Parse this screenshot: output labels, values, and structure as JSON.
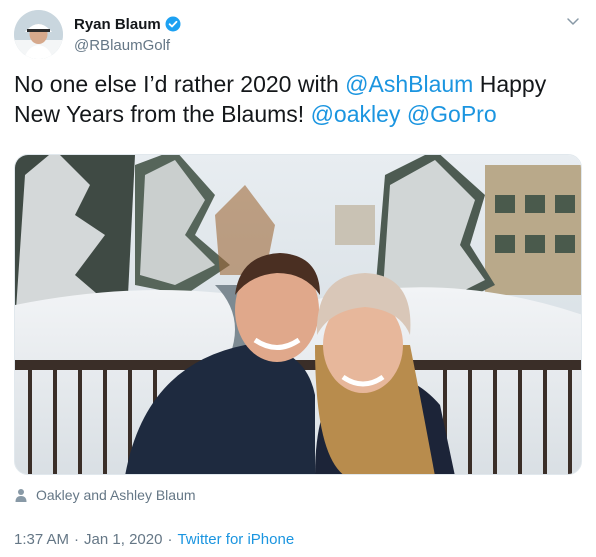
{
  "user": {
    "display_name": "Ryan Blaum",
    "handle": "@RBlaumGolf",
    "verified_icon": "verified-badge-icon",
    "caret_icon": "chevron-down-icon"
  },
  "tweet": {
    "text_part1": "No one else I’d rather 2020 with ",
    "mention1": "@AshBlaum",
    "text_part2": " Happy New Years from the Blaums! ",
    "mention2": "@oakley",
    "text_part3": " ",
    "mention3": "@GoPro"
  },
  "media": {
    "tagged_icon": "person-icon",
    "tagged_label": "Oakley and Ashley Blaum"
  },
  "meta": {
    "time": "1:37 AM",
    "separator": "·",
    "date": "Jan 1, 2020",
    "source": "Twitter for iPhone"
  },
  "colors": {
    "link": "#1b95e0",
    "secondary_text": "#657786",
    "primary_text": "#14171a",
    "verified": "#1da1f2"
  }
}
